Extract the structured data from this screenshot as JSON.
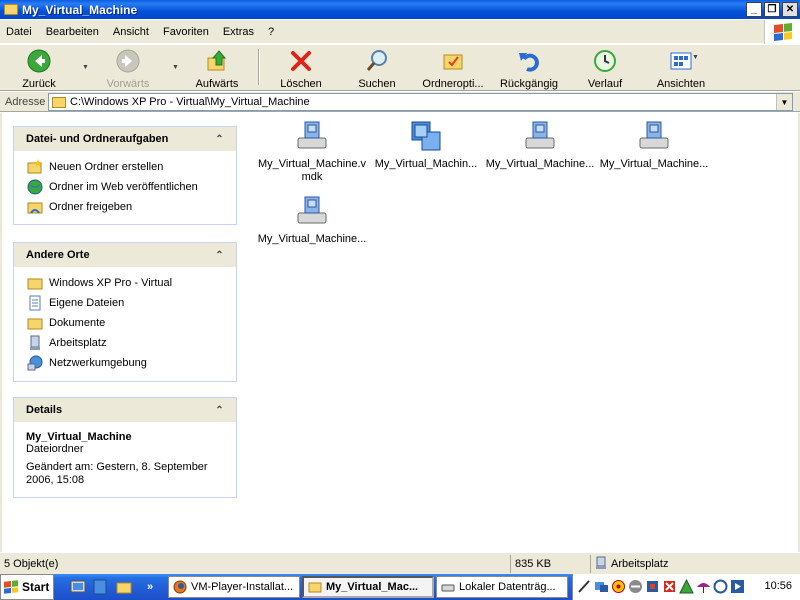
{
  "window": {
    "title": "My_Virtual_Machine",
    "min_label": "_",
    "max_label": "❐",
    "close_label": "✕"
  },
  "menu": [
    "Datei",
    "Bearbeiten",
    "Ansicht",
    "Favoriten",
    "Extras",
    "?"
  ],
  "toolbar": {
    "back": "Zurück",
    "forward": "Vorwärts",
    "up": "Aufwärts",
    "delete": "Löschen",
    "search": "Suchen",
    "folder_options": "Ordneropti...",
    "undo": "Rückgängig",
    "history": "Verlauf",
    "views": "Ansichten"
  },
  "address": {
    "label": "Adresse",
    "path": "C:\\Windows XP Pro - Virtual\\My_Virtual_Machine"
  },
  "tasks_panel": {
    "title": "Datei- und Ordneraufgaben",
    "items": [
      "Neuen Ordner erstellen",
      "Ordner im Web veröffentlichen",
      "Ordner freigeben"
    ]
  },
  "places_panel": {
    "title": "Andere Orte",
    "items": [
      "Windows XP Pro - Virtual",
      "Eigene Dateien",
      "Dokumente",
      "Arbeitsplatz",
      "Netzwerkumgebung"
    ]
  },
  "details_panel": {
    "title": "Details",
    "name": "My_Virtual_Machine",
    "type": "Dateiordner",
    "modified_line1": "Geändert am: Gestern, 8. September",
    "modified_line2": "2006, 15:08"
  },
  "files": [
    {
      "name": "My_Virtual_Machine.vmdk",
      "icon": "vmware-disk-icon"
    },
    {
      "name": "My_Virtual_Machin...",
      "icon": "vmware-config-icon"
    },
    {
      "name": "My_Virtual_Machine...",
      "icon": "vmware-disk-icon"
    },
    {
      "name": "My_Virtual_Machine...",
      "icon": "vmware-disk-icon"
    },
    {
      "name": "My_Virtual_Machine...",
      "icon": "vmware-disk-icon"
    }
  ],
  "status": {
    "objects": "5 Objekt(e)",
    "size": "835 KB",
    "location": "Arbeitsplatz"
  },
  "taskbar": {
    "start": "Start",
    "quicklaunch_more": "»",
    "tasks": [
      "VM-Player-Installat...",
      "My_Virtual_Mac...",
      "Lokaler Datenträg..."
    ],
    "clock": "10:56"
  },
  "colors": {
    "title_blue": "#0450d6",
    "panel_bg": "#ece9d8",
    "taskbar_blue": "#235bd6"
  }
}
